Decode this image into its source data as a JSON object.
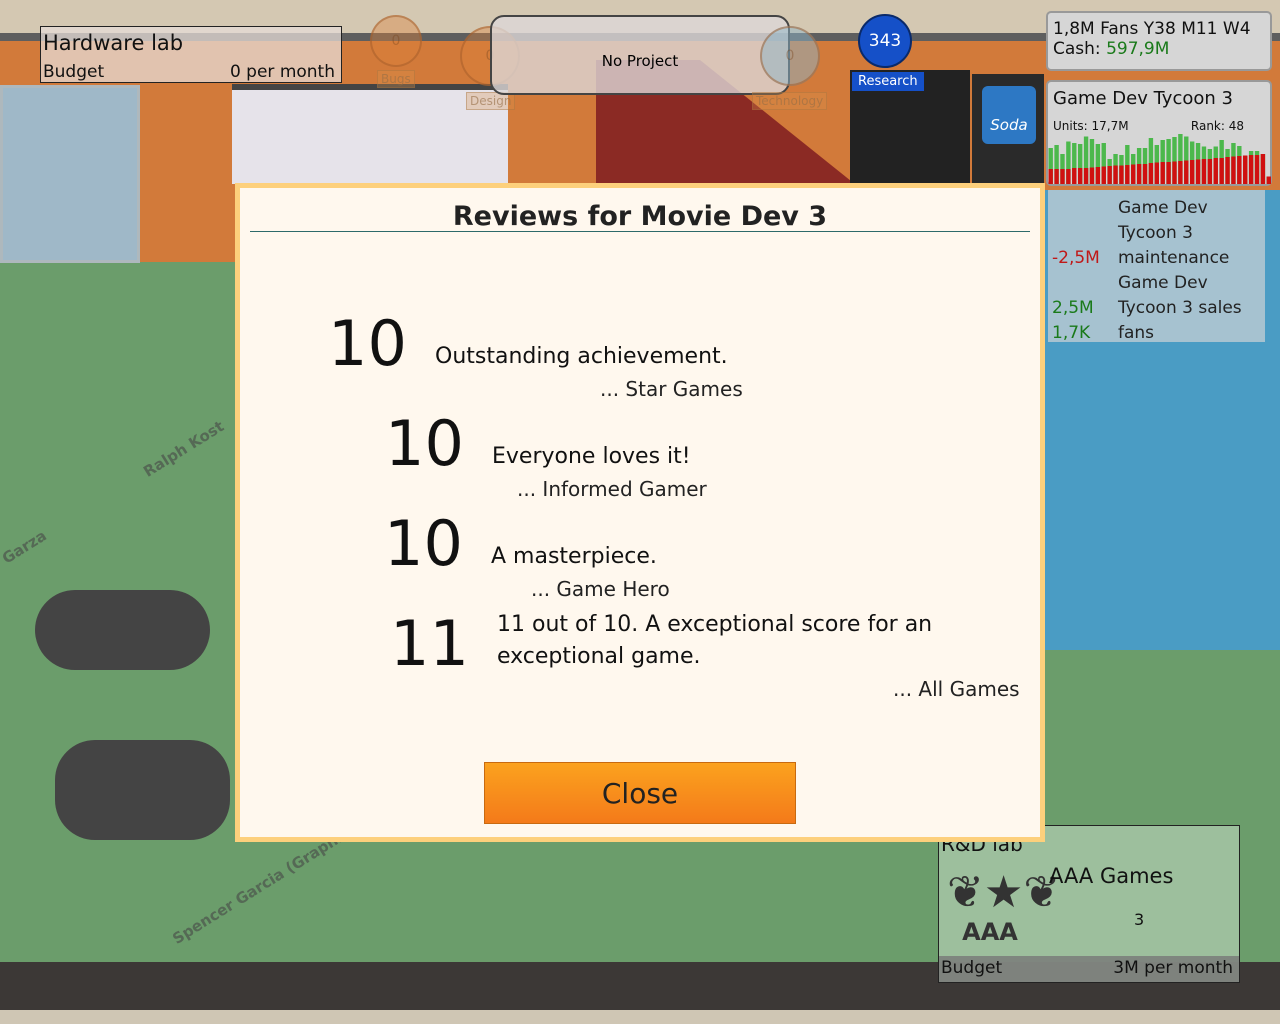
{
  "hardware_lab": {
    "title": "Hardware lab",
    "budget_label": "Budget",
    "budget_value": "0 per month"
  },
  "project": {
    "label": "No Project",
    "bugs_label": "Bugs",
    "design_label": "Design",
    "technology_label": "Technology",
    "bugs": "0",
    "design": "0",
    "technology": "0"
  },
  "research": {
    "points": "343",
    "label": "Research"
  },
  "vending": {
    "soda_label": "Soda"
  },
  "status": {
    "fans": "1,8M Fans",
    "date": "Y38 M11 W4",
    "cash_label": "Cash:",
    "cash_value": "597,9M"
  },
  "game": {
    "name": "Game Dev Tycoon 3",
    "units": "Units: 17,7M",
    "rank": "Rank: 48",
    "sales_bars": [
      {
        "g": 0.72,
        "r": 0.3
      },
      {
        "g": 0.78,
        "r": 0.3
      },
      {
        "g": 0.6,
        "r": 0.3
      },
      {
        "g": 0.85,
        "r": 0.3
      },
      {
        "g": 0.82,
        "r": 0.32
      },
      {
        "g": 0.8,
        "r": 0.32
      },
      {
        "g": 0.95,
        "r": 0.32
      },
      {
        "g": 0.9,
        "r": 0.33
      },
      {
        "g": 0.8,
        "r": 0.34
      },
      {
        "g": 0.82,
        "r": 0.35
      },
      {
        "g": 0.5,
        "r": 0.36
      },
      {
        "g": 0.6,
        "r": 0.37
      },
      {
        "g": 0.58,
        "r": 0.37
      },
      {
        "g": 0.78,
        "r": 0.38
      },
      {
        "g": 0.6,
        "r": 0.39
      },
      {
        "g": 0.72,
        "r": 0.4
      },
      {
        "g": 0.72,
        "r": 0.4
      },
      {
        "g": 0.92,
        "r": 0.42
      },
      {
        "g": 0.78,
        "r": 0.43
      },
      {
        "g": 0.88,
        "r": 0.44
      },
      {
        "g": 0.9,
        "r": 0.44
      },
      {
        "g": 0.94,
        "r": 0.45
      },
      {
        "g": 1.0,
        "r": 0.46
      },
      {
        "g": 0.95,
        "r": 0.47
      },
      {
        "g": 0.85,
        "r": 0.48
      },
      {
        "g": 0.82,
        "r": 0.49
      },
      {
        "g": 0.75,
        "r": 0.5
      },
      {
        "g": 0.7,
        "r": 0.5
      },
      {
        "g": 0.75,
        "r": 0.52
      },
      {
        "g": 0.88,
        "r": 0.52
      },
      {
        "g": 0.7,
        "r": 0.54
      },
      {
        "g": 0.82,
        "r": 0.55
      },
      {
        "g": 0.76,
        "r": 0.56
      },
      {
        "g": 0.56,
        "r": 0.57
      },
      {
        "g": 0.66,
        "r": 0.58
      },
      {
        "g": 0.66,
        "r": 0.58
      },
      {
        "g": 0.6,
        "r": 0.6
      },
      {
        "g": 0.15,
        "r": 0.15
      }
    ]
  },
  "finance": [
    {
      "amount": "",
      "label": "Game Dev"
    },
    {
      "amount": "",
      "label": "Tycoon 3"
    },
    {
      "amount": "-2,5M",
      "label": "maintenance",
      "type": "neg"
    },
    {
      "amount": "",
      "label": "Game Dev"
    },
    {
      "amount": "2,5M",
      "label": "Tycoon 3 sales",
      "type": "pos"
    },
    {
      "amount": "1,7K",
      "label": "fans",
      "type": "pos"
    }
  ],
  "dialog": {
    "title": "Reviews for Movie Dev 3",
    "close_label": "Close",
    "reviews": [
      {
        "score": "10",
        "text": "Outstanding achievement.",
        "author": "... Star Games"
      },
      {
        "score": "10",
        "text": "Everyone loves it!",
        "author": "... Informed Gamer"
      },
      {
        "score": "10",
        "text": "A masterpiece.",
        "author": "... Game Hero"
      },
      {
        "score": "11",
        "text": "11 out of 10. A exceptional score for an exceptional game.",
        "author": "... All Games"
      }
    ]
  },
  "staff": [
    "Ralph Kost",
    "Garza",
    "Spencer Garcia (Graphic)"
  ],
  "rd_lab": {
    "title": "R&D lab",
    "project": "AAA Games",
    "count": "3",
    "logo_text": "AAA",
    "budget_label": "Budget",
    "budget_value": "3M per month"
  },
  "colors": {
    "positive": "#1a7a1a",
    "negative": "#c01818",
    "close_button": "#f68c1c",
    "dialog_border": "#fdd07c"
  }
}
